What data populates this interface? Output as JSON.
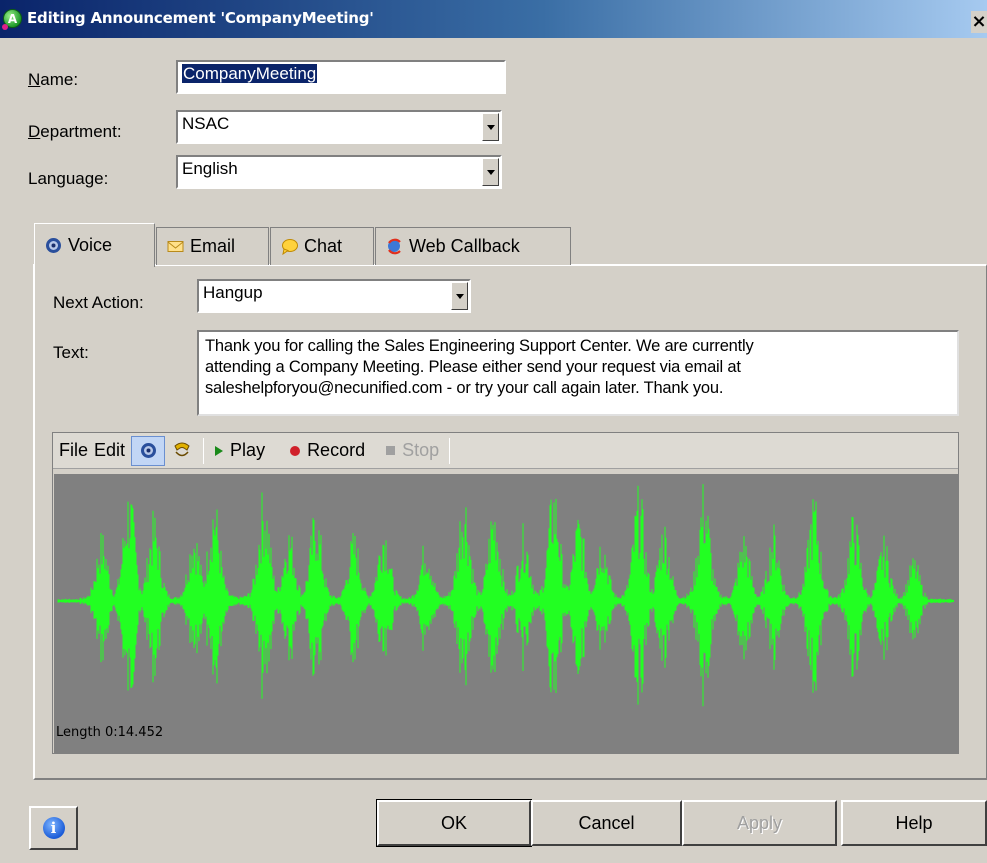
{
  "window": {
    "title": "Editing Announcement 'CompanyMeeting'",
    "close_glyph": "×"
  },
  "form": {
    "name": {
      "label_accel": "N",
      "label_rest": "ame:",
      "value": "CompanyMeeting"
    },
    "department": {
      "label_accel": "D",
      "label_rest": "epartment:",
      "value": "NSAC"
    },
    "language": {
      "label": "Language:",
      "value": "English"
    }
  },
  "tabs": [
    {
      "label": "Voice",
      "icon": "speaker-icon",
      "active": true
    },
    {
      "label": "Email",
      "icon": "envelope-icon",
      "active": false
    },
    {
      "label": "Chat",
      "icon": "chat-bubble-icon",
      "active": false
    },
    {
      "label": "Web Callback",
      "icon": "web-callback-icon",
      "active": false
    }
  ],
  "voice": {
    "next_action": {
      "label": "Next Action:",
      "value": "Hangup"
    },
    "text": {
      "label": "Text:",
      "lines": [
        "Thank you for calling the Sales Engineering Support Center.  We are currently",
        "attending a Company Meeting.  Please either send your request via email at",
        "saleshelpforyou@necunified.com - or try your call again later.  Thank you."
      ]
    },
    "toolbar": {
      "file": "File",
      "edit": "Edit",
      "play": "Play",
      "record": "Record",
      "stop": "Stop"
    },
    "waveform": {
      "length_label": "Length 0:14.452",
      "color": "#22ff22",
      "background": "#808080"
    }
  },
  "buttons": {
    "ok": "OK",
    "cancel": "Cancel",
    "apply": "Apply",
    "help": "Help",
    "info_glyph": "i"
  }
}
